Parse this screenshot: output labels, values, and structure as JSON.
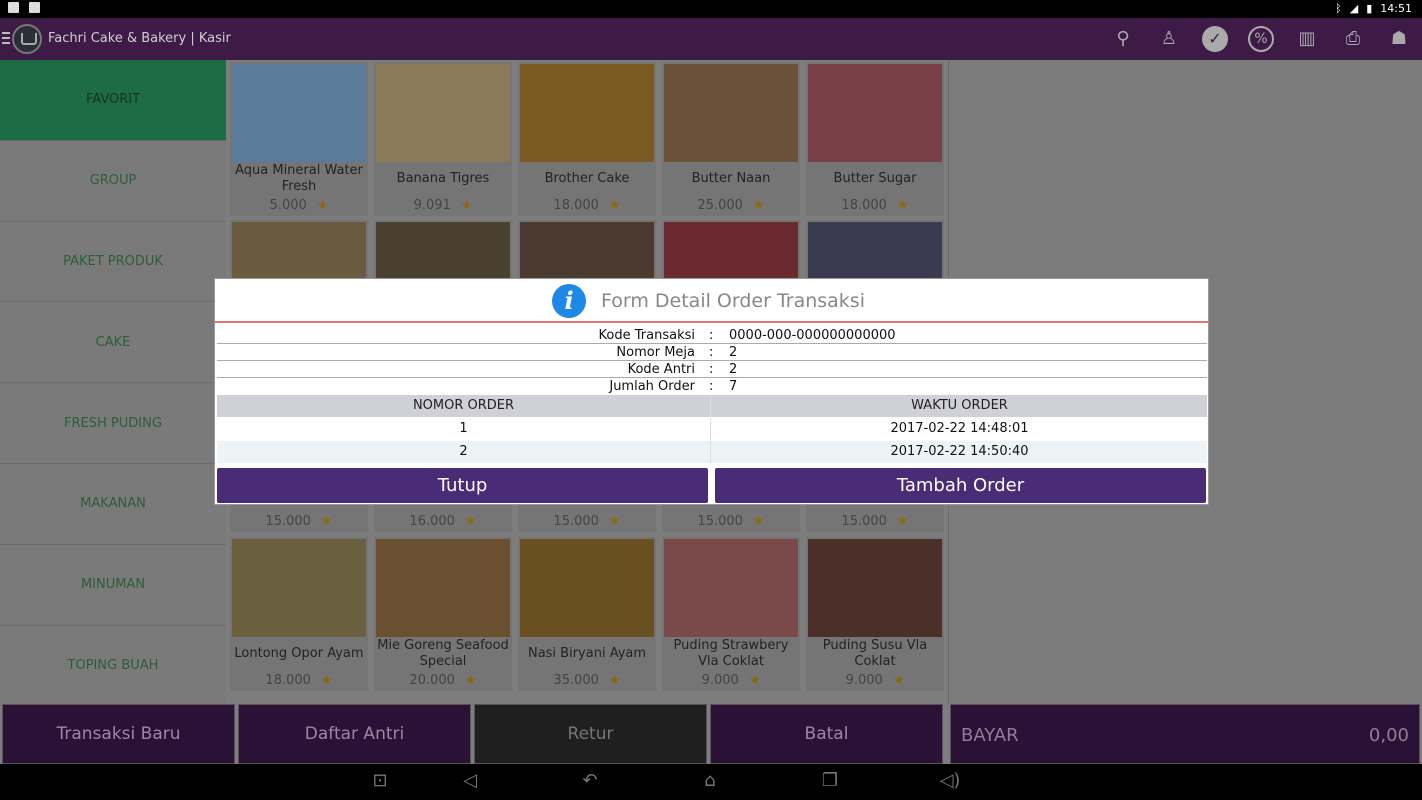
{
  "status": {
    "time": "14:51"
  },
  "app": {
    "title": "Fachri Cake & Bakery | Kasir"
  },
  "toolbar_icons": [
    "search-icon",
    "waiter-icon",
    "check-circle-icon",
    "percent-icon",
    "barcode-icon",
    "printer-icon",
    "table-service-icon"
  ],
  "categories": [
    "FAVORIT",
    "GROUP",
    "PAKET PRODUK",
    "CAKE",
    "FRESH PUDING",
    "MAKANAN",
    "MINUMAN",
    "TOPING BUAH"
  ],
  "products_row1": [
    {
      "name": "Aqua Mineral Water Fresh",
      "price": "5.000",
      "color": "#5a7b9a"
    },
    {
      "name": "Banana Tigres",
      "price": "9.091",
      "color": "#8a7a5a"
    },
    {
      "name": "Brother Cake",
      "price": "18.000",
      "color": "#7a5a20"
    },
    {
      "name": "Butter Naan",
      "price": "25.000",
      "color": "#6a5238"
    },
    {
      "name": "Butter Sugar",
      "price": "18.000",
      "color": "#7a4048"
    }
  ],
  "products_row3_prices": [
    "15.000",
    "16.000",
    "15.000",
    "15.000",
    "15.000"
  ],
  "products_row4": [
    {
      "name": "Lontong Opor Ayam",
      "price": "18.000",
      "color": "#6a6040"
    },
    {
      "name": "Mie Goreng Seafood Special",
      "price": "20.000",
      "color": "#6a5030"
    },
    {
      "name": "Nasi Biryani Ayam",
      "price": "35.000",
      "color": "#6a5020"
    },
    {
      "name": "Puding Strawbery Vla Coklat",
      "price": "9.000",
      "color": "#7a4a4a"
    },
    {
      "name": "Puding Susu Vla Coklat",
      "price": "9.000",
      "color": "#4a3028"
    }
  ],
  "row2_colors": [
    "#6a5a40",
    "#4a4030",
    "#4a3a30",
    "#6a2a30",
    "#3a3a50"
  ],
  "bottom": {
    "transaksi_baru": "Transaksi Baru",
    "daftar_antri": "Daftar Antri",
    "retur": "Retur",
    "batal": "Batal",
    "bayar_label": "BAYAR",
    "bayar_value": "0,00"
  },
  "dialog": {
    "title": "Form Detail Order Transaksi",
    "fields": [
      {
        "label": "Kode Transaksi",
        "sep": ":",
        "value": "0000-000-000000000000"
      },
      {
        "label": "Nomor Meja",
        "sep": ":",
        "value": "2"
      },
      {
        "label": "Kode Antri",
        "sep": ":",
        "value": "2"
      },
      {
        "label": "Jumlah Order",
        "sep": ":",
        "value": "7"
      }
    ],
    "table": {
      "headers": [
        "NOMOR ORDER",
        "WAKTU ORDER"
      ],
      "rows": [
        [
          "1",
          "2017-02-22 14:48:01"
        ],
        [
          "2",
          "2017-02-22 14:50:40"
        ]
      ]
    },
    "btn_close": "Tutup",
    "btn_add": "Tambah Order"
  },
  "colors": {
    "primary": "#4a2b76",
    "accent_red": "#e57373",
    "info_blue": "#1e88e5"
  }
}
